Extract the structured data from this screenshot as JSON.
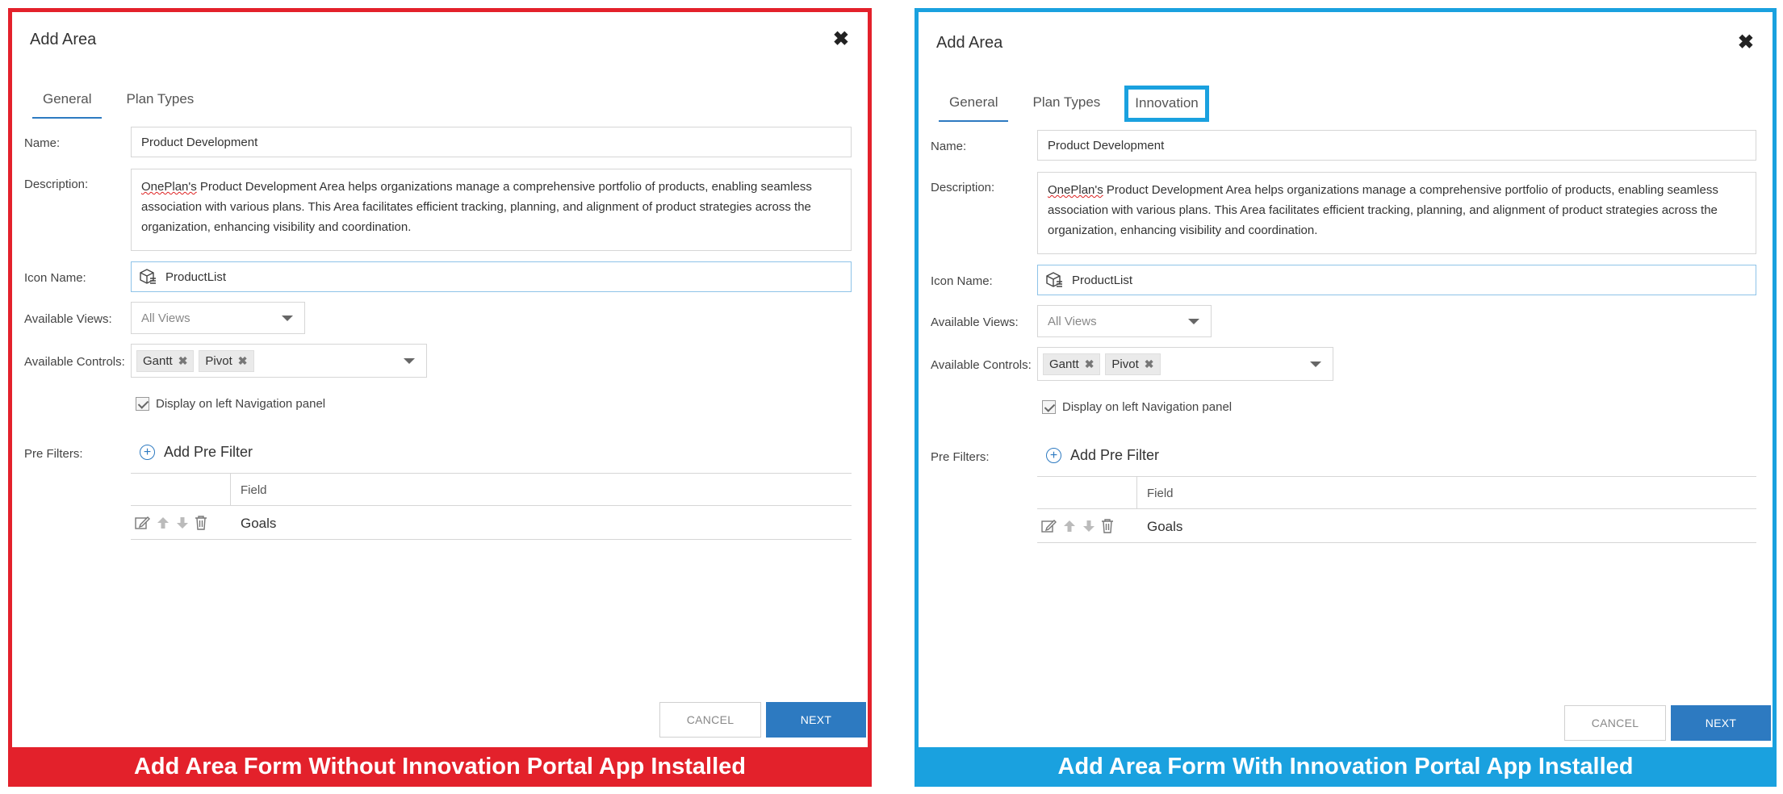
{
  "panels": [
    {
      "dialog_title": "Add Area",
      "tabs": [
        "General",
        "Plan Types"
      ],
      "labels": {
        "name": "Name:",
        "description": "Description:",
        "icon_name": "Icon Name:",
        "available_views": "Available Views:",
        "available_controls": "Available Controls:",
        "pre_filters": "Pre Filters:"
      },
      "name_value": "Product Development",
      "description": {
        "word1": "OnePlan's",
        "rest": " Product Development Area helps organizations manage a comprehensive portfolio of products, enabling seamless association with various plans. This Area facilitates efficient tracking, planning, and alignment of product strategies across the organization, enhancing visibility and coordination."
      },
      "icon_value": "ProductList",
      "views_value": "All Views",
      "controls": [
        "Gantt",
        "Pivot"
      ],
      "checkbox_label": "Display on left Navigation panel",
      "add_pre_filter": "Add Pre Filter",
      "grid_header": "Field",
      "grid_row": "Goals",
      "cancel": "CANCEL",
      "next": "NEXT",
      "caption": "Add Area Form Without Innovation Portal App Installed"
    },
    {
      "dialog_title": "Add Area",
      "tabs": [
        "General",
        "Plan Types",
        "Innovation"
      ],
      "labels": {
        "name": "Name:",
        "description": "Description:",
        "icon_name": "Icon Name:",
        "available_views": "Available Views:",
        "available_controls": "Available Controls:",
        "pre_filters": "Pre Filters:"
      },
      "name_value": "Product Development",
      "description": {
        "word1": "OnePlan's",
        "rest": " Product Development Area helps organizations manage a comprehensive portfolio of products, enabling seamless association with various plans. This Area facilitates efficient tracking, planning, and alignment of product strategies across the organization, enhancing visibility and coordination."
      },
      "icon_value": "ProductList",
      "views_value": "All Views",
      "controls": [
        "Gantt",
        "Pivot"
      ],
      "checkbox_label": "Display on left Navigation panel",
      "add_pre_filter": "Add Pre Filter",
      "grid_header": "Field",
      "grid_row": "Goals",
      "cancel": "CANCEL",
      "next": "NEXT",
      "caption": "Add Area Form With Innovation Portal App Installed"
    }
  ],
  "colors": {
    "left_frame": "#e3212b",
    "right_frame": "#1aa1df",
    "primary_button": "#2d7ac1"
  },
  "icons": [
    "close-icon",
    "package-icon",
    "chevron-down-icon",
    "remove-chip-icon",
    "check-icon",
    "plus-circle-icon",
    "edit-icon",
    "arrow-up-icon",
    "arrow-down-icon",
    "trash-icon"
  ]
}
